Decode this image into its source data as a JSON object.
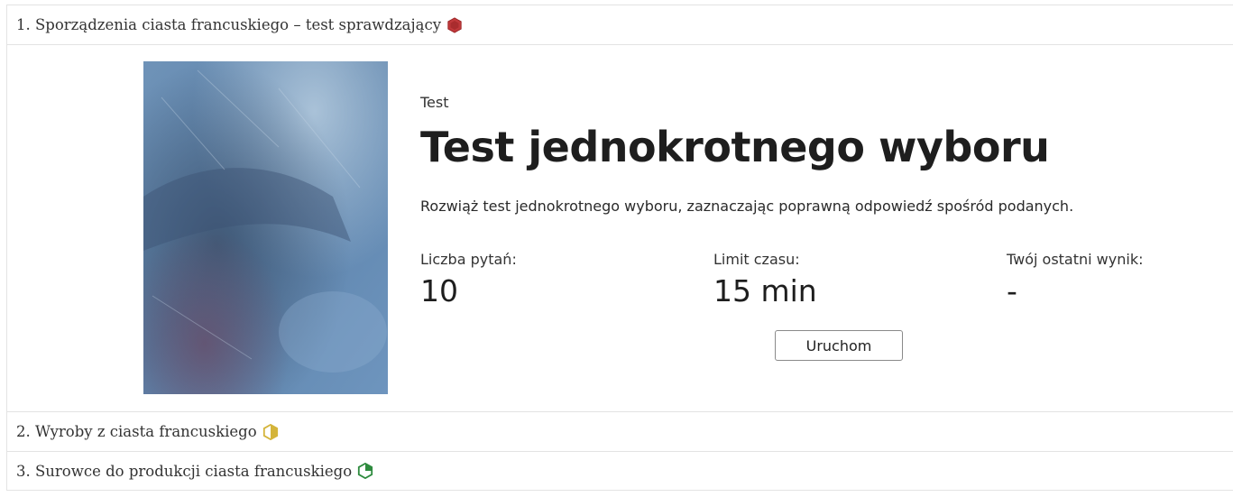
{
  "sections": [
    {
      "label": "1. Sporządzenia ciasta francuskiego – test sprawdzający",
      "status_color": "#c0393b",
      "icon": "hexagon-filled-icon"
    },
    {
      "label": "2. Wyroby z ciasta francuskiego",
      "status_color": "#d4b43a",
      "icon": "hexagon-half-icon"
    },
    {
      "label": "3. Surowce do produkcji ciasta francuskiego",
      "status_color": "#2e8b3e",
      "icon": "hexagon-quarter-icon"
    }
  ],
  "test": {
    "kind": "Test",
    "title": "Test jednokrotnego wyboru",
    "description": "Rozwiąż test jednokrotnego wyboru, zaznaczając poprawną odpowiedź spośród podanych.",
    "questions_label": "Liczba pytań:",
    "questions_value": "10",
    "time_label": "Limit czasu:",
    "time_value": "15 min",
    "score_label": "Twój ostatni wynik:",
    "score_value": "-",
    "start_label": "Uruchom"
  }
}
